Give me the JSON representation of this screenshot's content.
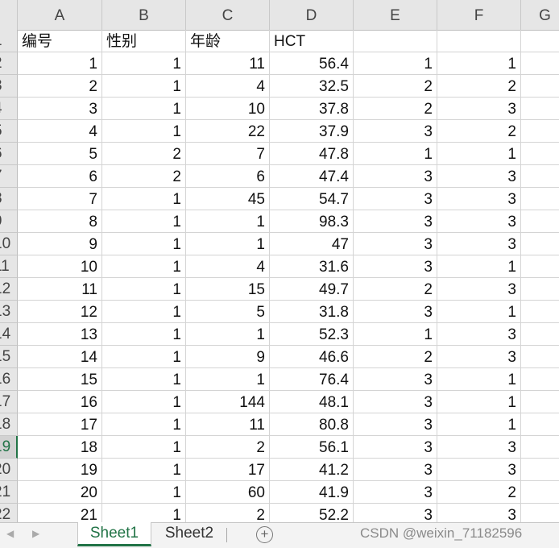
{
  "columns": [
    "A",
    "B",
    "C",
    "D",
    "E",
    "F",
    "G"
  ],
  "row_numbers": [
    "1",
    "2",
    "3",
    "4",
    "5",
    "6",
    "7",
    "8",
    "9",
    "10",
    "11",
    "12",
    "13",
    "14",
    "15",
    "16",
    "17",
    "18",
    "19",
    "20",
    "21",
    "22"
  ],
  "selected_row_index": 18,
  "header_cells": [
    "编号",
    "性别",
    "年龄",
    "HCT",
    "",
    ""
  ],
  "rows": [
    [
      "1",
      "1",
      "11",
      "56.4",
      "1",
      "1"
    ],
    [
      "2",
      "1",
      "4",
      "32.5",
      "2",
      "2"
    ],
    [
      "3",
      "1",
      "10",
      "37.8",
      "2",
      "3"
    ],
    [
      "4",
      "1",
      "22",
      "37.9",
      "3",
      "2"
    ],
    [
      "5",
      "2",
      "7",
      "47.8",
      "1",
      "1"
    ],
    [
      "6",
      "2",
      "6",
      "47.4",
      "3",
      "3"
    ],
    [
      "7",
      "1",
      "45",
      "54.7",
      "3",
      "3"
    ],
    [
      "8",
      "1",
      "1",
      "98.3",
      "3",
      "3"
    ],
    [
      "9",
      "1",
      "1",
      "47",
      "3",
      "3"
    ],
    [
      "10",
      "1",
      "4",
      "31.6",
      "3",
      "1"
    ],
    [
      "11",
      "1",
      "15",
      "49.7",
      "2",
      "3"
    ],
    [
      "12",
      "1",
      "5",
      "31.8",
      "3",
      "1"
    ],
    [
      "13",
      "1",
      "1",
      "52.3",
      "1",
      "3"
    ],
    [
      "14",
      "1",
      "9",
      "46.6",
      "2",
      "3"
    ],
    [
      "15",
      "1",
      "1",
      "76.4",
      "3",
      "1"
    ],
    [
      "16",
      "1",
      "144",
      "48.1",
      "3",
      "1"
    ],
    [
      "17",
      "1",
      "11",
      "80.8",
      "3",
      "1"
    ],
    [
      "18",
      "1",
      "2",
      "56.1",
      "3",
      "3"
    ],
    [
      "19",
      "1",
      "17",
      "41.2",
      "3",
      "3"
    ],
    [
      "20",
      "1",
      "60",
      "41.9",
      "3",
      "2"
    ],
    [
      "21",
      "1",
      "2",
      "52.2",
      "3",
      "3"
    ]
  ],
  "tabs": {
    "sheet1": "Sheet1",
    "sheet2": "Sheet2",
    "add": "+"
  },
  "nav": {
    "prev": "◀",
    "next": "▶"
  },
  "watermark": "CSDN @weixin_71182596",
  "colors": {
    "accent": "#217346",
    "header_bg": "#e6e6e6",
    "gridline": "#d4d4d4"
  }
}
